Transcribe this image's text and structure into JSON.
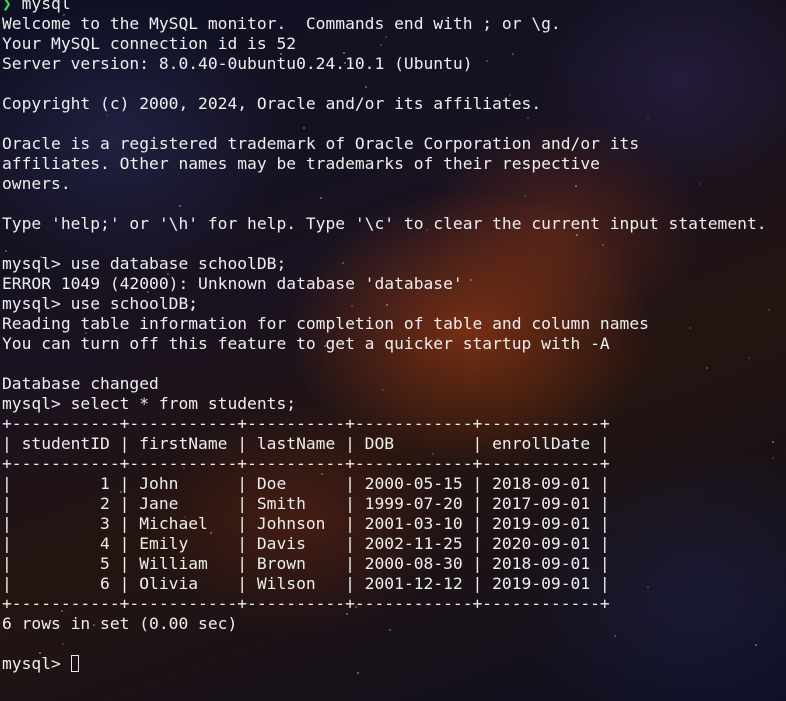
{
  "shell": {
    "prompt_symbol": "❯",
    "command": "mysql"
  },
  "output_lines": [
    "Welcome to the MySQL monitor.  Commands end with ; or \\g.",
    "Your MySQL connection id is 52",
    "Server version: 8.0.40-0ubuntu0.24.10.1 (Ubuntu)",
    "",
    "Copyright (c) 2000, 2024, Oracle and/or its affiliates.",
    "",
    "Oracle is a registered trademark of Oracle Corporation and/or its",
    "affiliates. Other names may be trademarks of their respective",
    "owners.",
    "",
    "Type 'help;' or '\\h' for help. Type '\\c' to clear the current input statement.",
    "",
    "mysql> use database schoolDB;",
    "ERROR 1049 (42000): Unknown database 'database'",
    "mysql> use schoolDB;",
    "Reading table information for completion of table and column names",
    "You can turn off this feature to get a quicker startup with -A",
    "",
    "Database changed",
    "mysql> select * from students;",
    "+-----------+-----------+----------+------------+------------+",
    "| studentID | firstName | lastName | DOB        | enrollDate |",
    "+-----------+-----------+----------+------------+------------+",
    "|         1 | John      | Doe      | 2000-05-15 | 2018-09-01 |",
    "|         2 | Jane      | Smith    | 1999-07-20 | 2017-09-01 |",
    "|         3 | Michael   | Johnson  | 2001-03-10 | 2019-09-01 |",
    "|         4 | Emily     | Davis    | 2002-11-25 | 2020-09-01 |",
    "|         5 | William   | Brown    | 2000-08-30 | 2018-09-01 |",
    "|         6 | Olivia    | Wilson   | 2001-12-12 | 2019-09-01 |",
    "+-----------+-----------+----------+------------+------------+",
    "6 rows in set (0.00 sec)",
    ""
  ],
  "current_prompt": "mysql> ",
  "colors": {
    "text": "#eeeeee",
    "prompt_arrow": "#3ddc4f"
  }
}
